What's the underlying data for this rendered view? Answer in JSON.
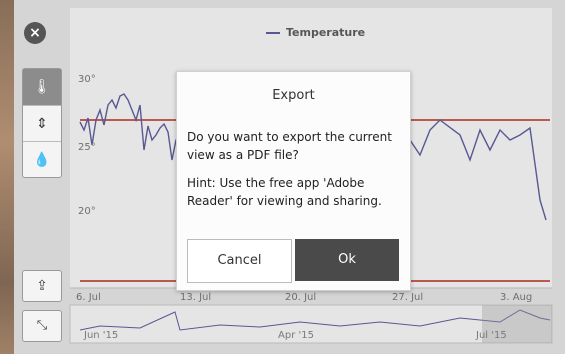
{
  "chart": {
    "y_ticks": [
      "30°",
      "25°",
      "20°"
    ],
    "x_ticks": [
      "6. Jul",
      "13. Jul",
      "20. Jul",
      "27. Jul",
      "3. Aug"
    ],
    "legend_label": "Temperature",
    "overview_ticks": [
      "Jun '15",
      "Apr '15",
      "Jul '15"
    ]
  },
  "chart_data": {
    "type": "line",
    "series": [
      {
        "name": "Temperature"
      }
    ],
    "x": [
      "6. Jul",
      "13. Jul",
      "20. Jul",
      "27. Jul",
      "3. Aug"
    ],
    "colors": {
      "line": "#35358a",
      "threshold": "#c0392b"
    }
  },
  "sidebar": {
    "close_icon": "×",
    "temp_icon": "🌡",
    "sort_icon": "⇕",
    "humidity_icon": "💧",
    "share_icon": "⇪",
    "collapse_icon": "⤡"
  },
  "dialog": {
    "title": "Export",
    "message": "Do you want to export the current view as a PDF file?",
    "hint": "Hint: Use the free app 'Adobe Reader' for viewing and sharing.",
    "cancel_label": "Cancel",
    "ok_label": "Ok"
  }
}
